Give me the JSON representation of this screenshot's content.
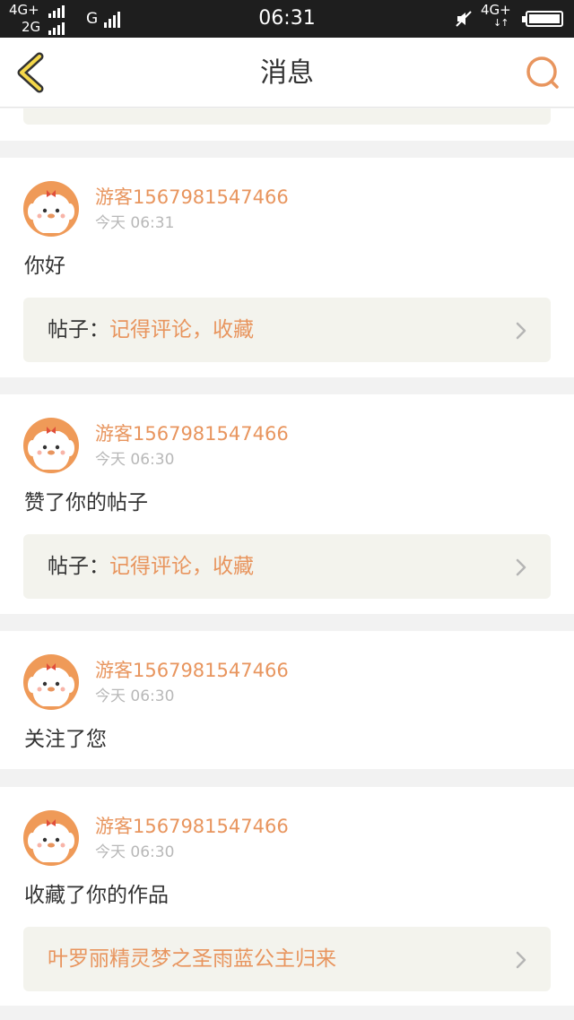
{
  "status_bar": {
    "net_top": "4G+",
    "net_bottom": "2G",
    "net_g": "G",
    "time": "06:31",
    "net_right": "4G+",
    "net_right_arrows": "↓↑"
  },
  "header": {
    "title": "消息",
    "back_icon": "chevron-left-icon",
    "search_icon": "search-icon",
    "accent": "#e8955e"
  },
  "notifications": [
    {
      "user": "游客1567981547466",
      "time": "今天 06:31",
      "message": "你好",
      "ref_prefix": "帖子：",
      "ref_title": "记得评论，收藏"
    },
    {
      "user": "游客1567981547466",
      "time": "今天 06:30",
      "message": "赞了你的帖子",
      "ref_prefix": "帖子：",
      "ref_title": "记得评论，收藏"
    },
    {
      "user": "游客1567981547466",
      "time": "今天 06:30",
      "message": "关注了您"
    },
    {
      "user": "游客1567981547466",
      "time": "今天 06:30",
      "message": "收藏了你的作品",
      "ref_title": "叶罗丽精灵梦之圣雨蓝公主归来"
    }
  ]
}
